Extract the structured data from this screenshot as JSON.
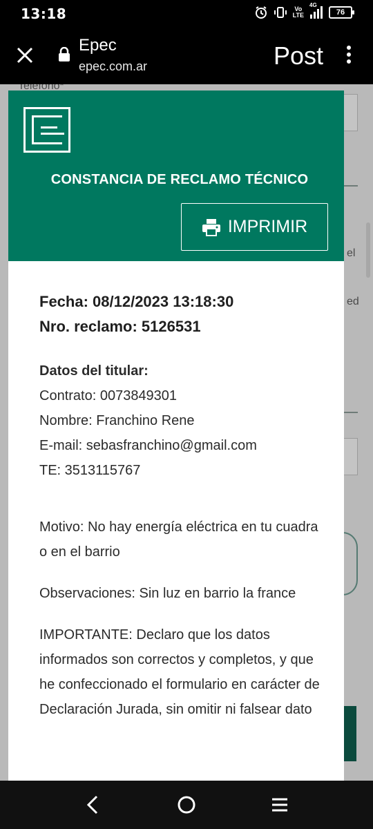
{
  "status_bar": {
    "time": "13:18",
    "network_top": "Vo",
    "network_bottom": "LTE",
    "signal_label": "4G",
    "battery": "76"
  },
  "browser": {
    "title": "Epec",
    "url": "epec.com.ar",
    "post_label": "Post"
  },
  "background_page": {
    "label_fragment": "Teléfono*",
    "text_fragment_1": "el",
    "text_fragment_2": "ed"
  },
  "modal": {
    "title": "CONSTANCIA DE RECLAMO TÉCNICO",
    "print_label": "IMPRIMIR",
    "fecha": "Fecha: 08/12/2023 13:18:30",
    "nro_reclamo": "Nro. reclamo: 5126531",
    "datos_titular_heading": "Datos del titular:",
    "contrato": "Contrato: 0073849301",
    "nombre": "Nombre: Franchino Rene",
    "email": "E-mail: sebasfranchino@gmail.com",
    "te": "TE: 3513115767",
    "motivo": "Motivo: No hay energía eléctrica en tu cuadra o en el barrio",
    "observaciones": "Observaciones: Sin luz en barrio la france",
    "importante": "IMPORTANTE: Declaro que los datos informados son correctos y completos, y que he confeccionado el formulario en carácter de Declaración Jurada, sin omitir ni falsear dato"
  },
  "colors": {
    "brand_green": "#00785f",
    "overlay_gray": "#b9b9b9"
  }
}
